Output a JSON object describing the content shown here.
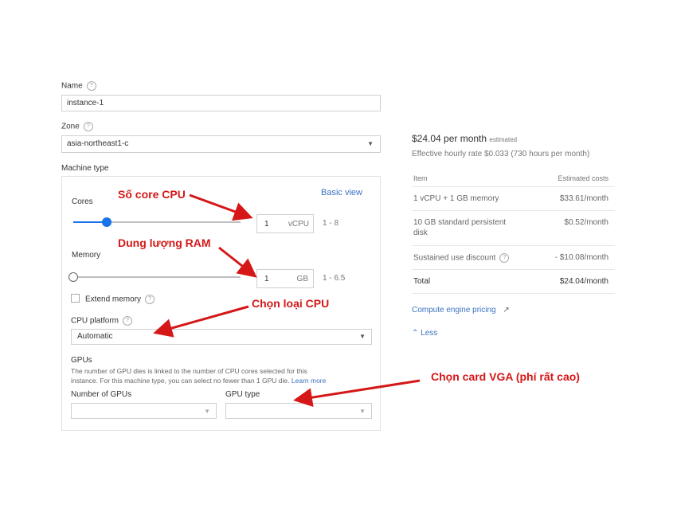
{
  "form": {
    "name_label": "Name",
    "name_value": "instance-1",
    "zone_label": "Zone",
    "zone_value": "asia-northeast1-c",
    "machine_type_label": "Machine type",
    "cores_label": "Cores",
    "basic_view_link": "Basic view",
    "cores_value": "1",
    "cores_unit": "vCPU",
    "cores_range": "1 - 8",
    "cores_slider_fraction": 0.1,
    "memory_label": "Memory",
    "memory_value": "1",
    "memory_unit": "GB",
    "memory_range": "1 - 6.5",
    "memory_slider_fraction": 0.0,
    "extend_memory_label": "Extend memory",
    "extend_memory_checked": false,
    "cpu_platform_label": "CPU platform",
    "cpu_platform_value": "Automatic",
    "gpus_title": "GPUs",
    "gpus_description_1": "The number of GPU dies is linked to the number of CPU cores selected for this",
    "gpus_description_2": "instance. For this machine type, you can select no fewer than 1 GPU die.",
    "learn_more_link": "Learn more",
    "num_gpus_label": "Number of GPUs",
    "gpu_type_label": "GPU type"
  },
  "pricing": {
    "price": "$24.04 per month",
    "estimated": "estimated",
    "hourly": "Effective hourly rate $0.033 (730 hours per month)",
    "col_item": "Item",
    "col_cost": "Estimated costs",
    "rows": [
      {
        "item": "1 vCPU + 1 GB memory",
        "cost": "$33.61/month"
      },
      {
        "item": "10 GB standard persistent",
        "item2": "disk",
        "cost": "$0.52/month"
      },
      {
        "item": "Sustained use discount",
        "cost": "- $10.08/month"
      },
      {
        "item": "Total",
        "cost": "$24.04/month"
      }
    ],
    "pricing_link": "Compute engine pricing",
    "less_link": "Less"
  },
  "annotations": {
    "cpu": "Số core CPU",
    "ram": "Dung lượng RAM",
    "cpu_type": "Chọn loại CPU",
    "vga": "Chọn card VGA (phí rất cao)"
  },
  "colors": {
    "accent": "#1a73e8",
    "annotation": "#d51717",
    "link": "#3a72c4"
  },
  "icons": [
    "help-icon",
    "dropdown-caret-icon",
    "external-link-icon",
    "chevron-up-icon",
    "checkbox-icon"
  ]
}
